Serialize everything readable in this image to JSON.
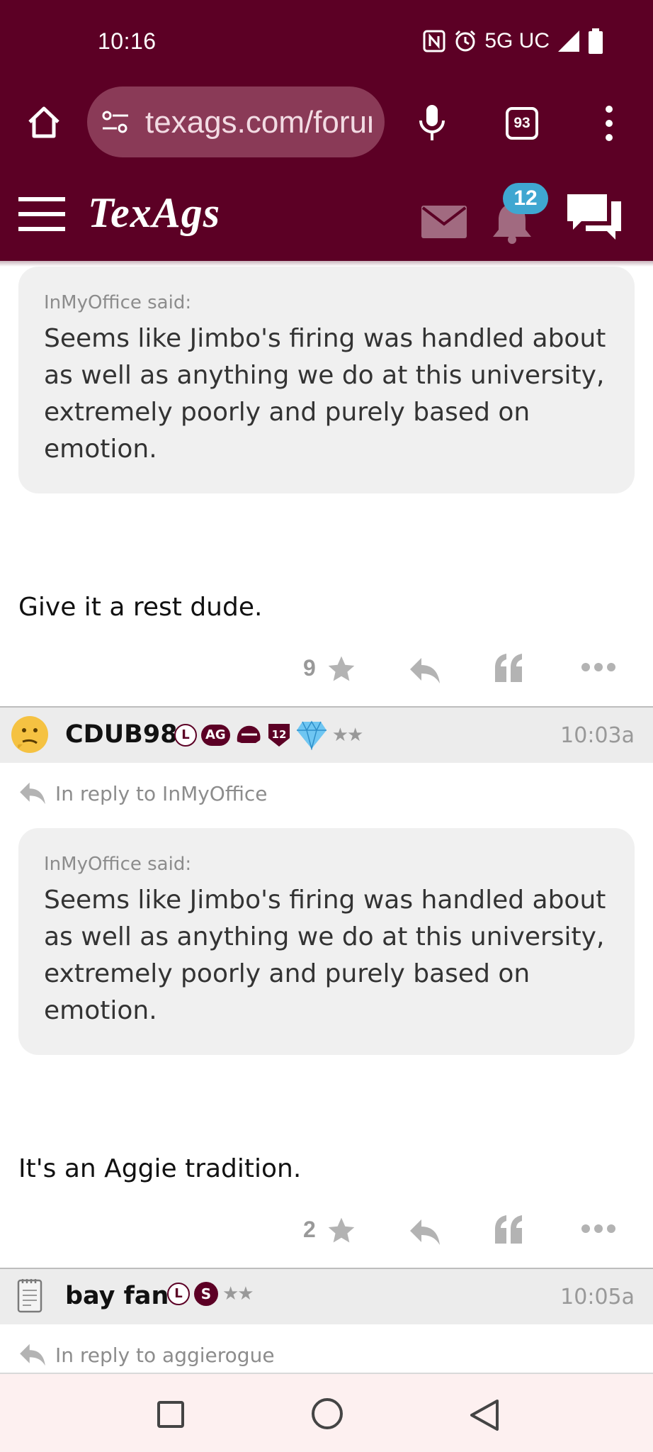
{
  "status_bar": {
    "time": "10:16",
    "network": "5G UC"
  },
  "browser": {
    "url": "texags.com/forums",
    "tab_count": "93"
  },
  "site": {
    "logo": "TexAgs",
    "notification_count": "12",
    "brand_color": "#5c0025"
  },
  "posts": [
    {
      "quote_author": "InMyOffice said:",
      "quote_text": "Seems like Jimbo's firing was handled about as well as anything we do at this university, extremely poorly and purely based on emotion.",
      "text": "Give it a rest dude.",
      "stars": "9"
    },
    {
      "username": "CDUB98",
      "badge_l": "L",
      "badge_ag": "AG",
      "badge_12": "12",
      "rank_stars": "★★",
      "time": "10:03a",
      "reply_to": "In reply to InMyOffice",
      "quote_author": "InMyOffice said:",
      "quote_text": "Seems like Jimbo's firing was handled about as well as anything we do at this university, extremely poorly and purely based on emotion.",
      "text": "It's an Aggie tradition.",
      "stars": "2"
    },
    {
      "username": "bay fan",
      "badge_l": "L",
      "badge_s": "S",
      "rank_stars": "★★",
      "time": "10:05a",
      "reply_to": "In reply to aggierogue"
    }
  ]
}
